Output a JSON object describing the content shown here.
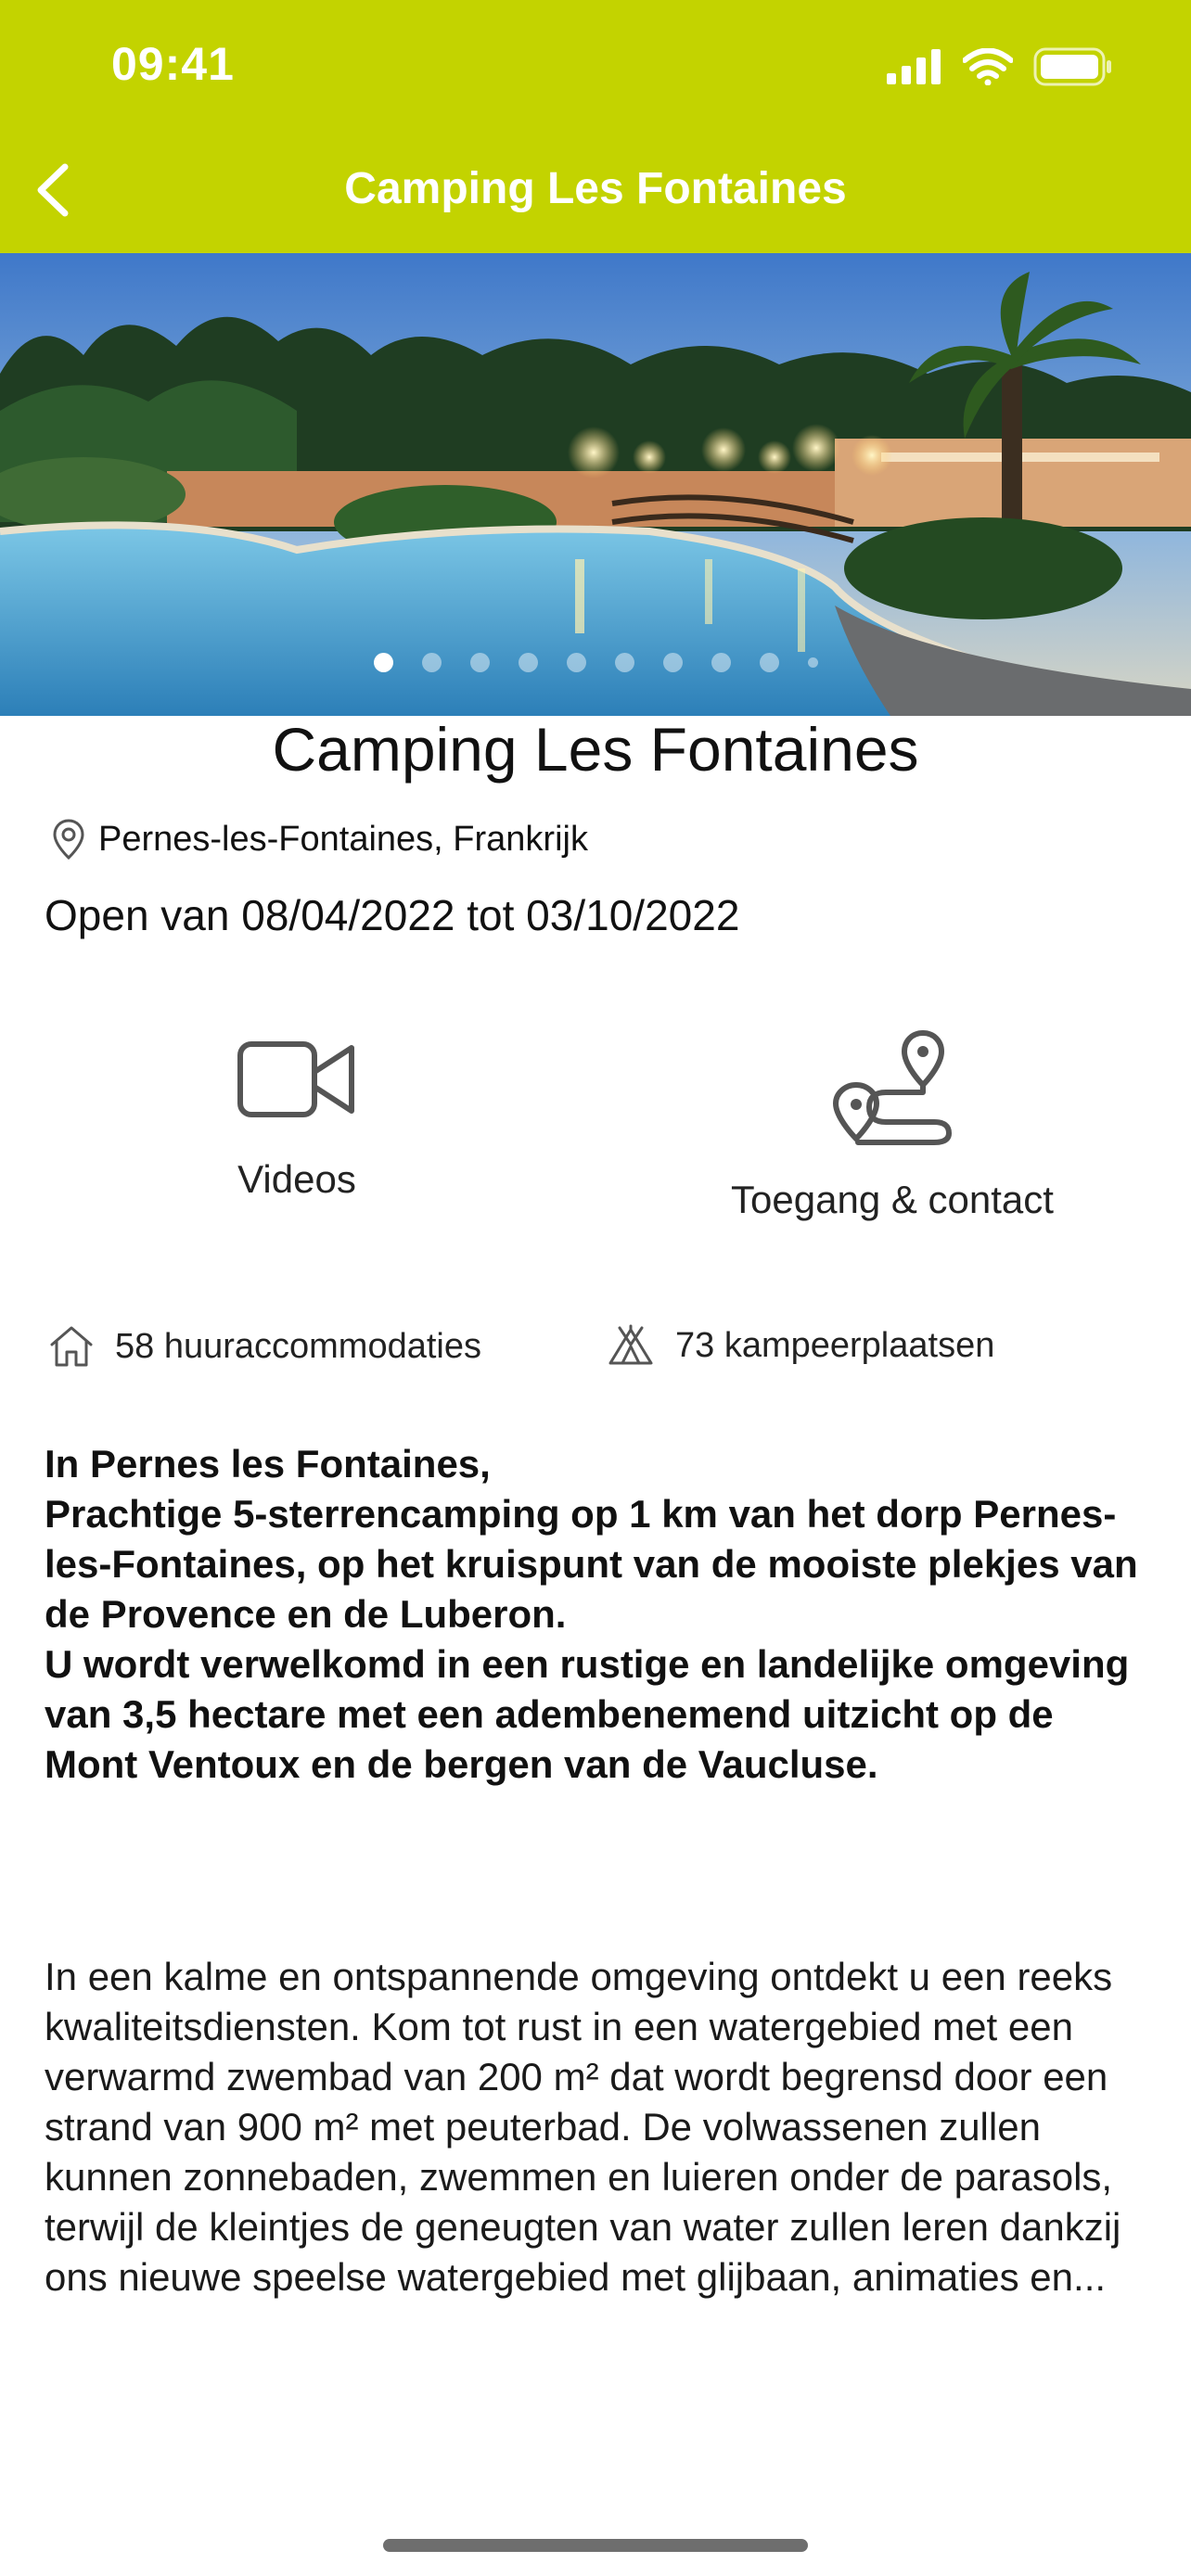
{
  "status_bar": {
    "time": "09:41"
  },
  "nav": {
    "title": "Camping Les Fontaines"
  },
  "gallery": {
    "page_count": 10,
    "current_page": 1
  },
  "camping": {
    "name": "Camping Les Fontaines",
    "location": "Pernes-les-Fontaines, Frankrijk",
    "dates": "Open van 08/04/2022 tot 03/10/2022"
  },
  "actions": {
    "videos_label": "Videos",
    "contact_label": "Toegang & contact"
  },
  "stats": {
    "rentals": "58 huuraccommodaties",
    "pitches": "73 kampeerplaatsen"
  },
  "description": {
    "bold": "In Pernes les Fontaines,\nPrachtige 5-sterrencamping op 1 km van het dorp Pernes-les-Fontaines, op het kruispunt van de mooiste plekjes van de Provence en de Luberon.\nU wordt verwelkomd in een rustige en landelijke omgeving van 3,5 hectare met een adembenemend uitzicht op de Mont Ventoux en de bergen van de Vaucluse.",
    "body": "In een kalme en ontspannende omgeving ontdekt u een reeks kwaliteitsdiensten. Kom tot rust in een watergebied met een verwarmd zwembad van 200 m² dat wordt begrensd door een strand van 900 m² met peuterbad. De volwassenen zullen kunnen zonnebaden, zwemmen en luieren onder de parasols, terwijl de kleintjes de geneugten van water zullen leren dankzij ons nieuwe speelse watergebied met glijbaan, animaties en..."
  },
  "colors": {
    "accent": "#c3d300",
    "icon": "#555555"
  }
}
